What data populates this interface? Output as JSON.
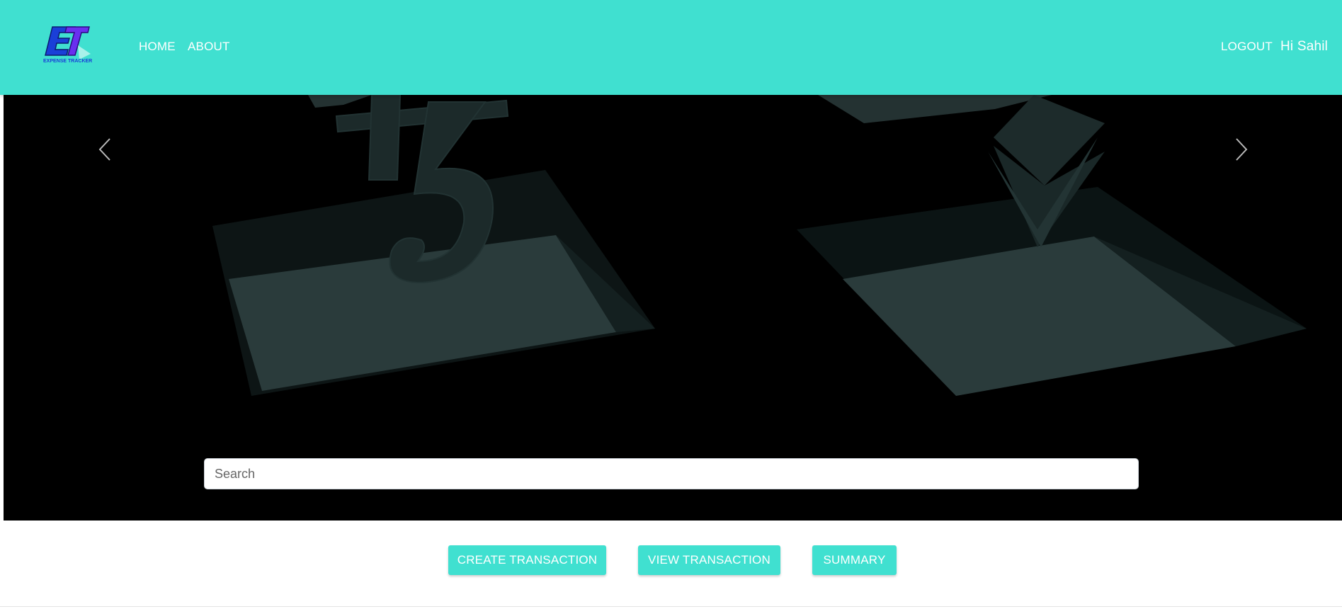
{
  "app": {
    "logo_name": "ET expense tracker logo",
    "logo_text": "EXPENSE TRACKER",
    "logo_letters": "ET"
  },
  "nav": {
    "home": "HOME",
    "about": "ABOUT",
    "logout": "LOGOUT",
    "greeting": "Hi Sahil"
  },
  "carousel": {
    "prev_icon": "chevron-left-icon",
    "next_icon": "chevron-right-icon"
  },
  "search": {
    "placeholder": "Search",
    "value": ""
  },
  "actions": {
    "create": "CREATE TRANSACTION",
    "view": "VIEW TRANSACTION",
    "summary": "SUMMARY"
  },
  "colors": {
    "accent": "#40e0d0",
    "hero_bg": "#000000",
    "button_text": "#ffffff"
  }
}
